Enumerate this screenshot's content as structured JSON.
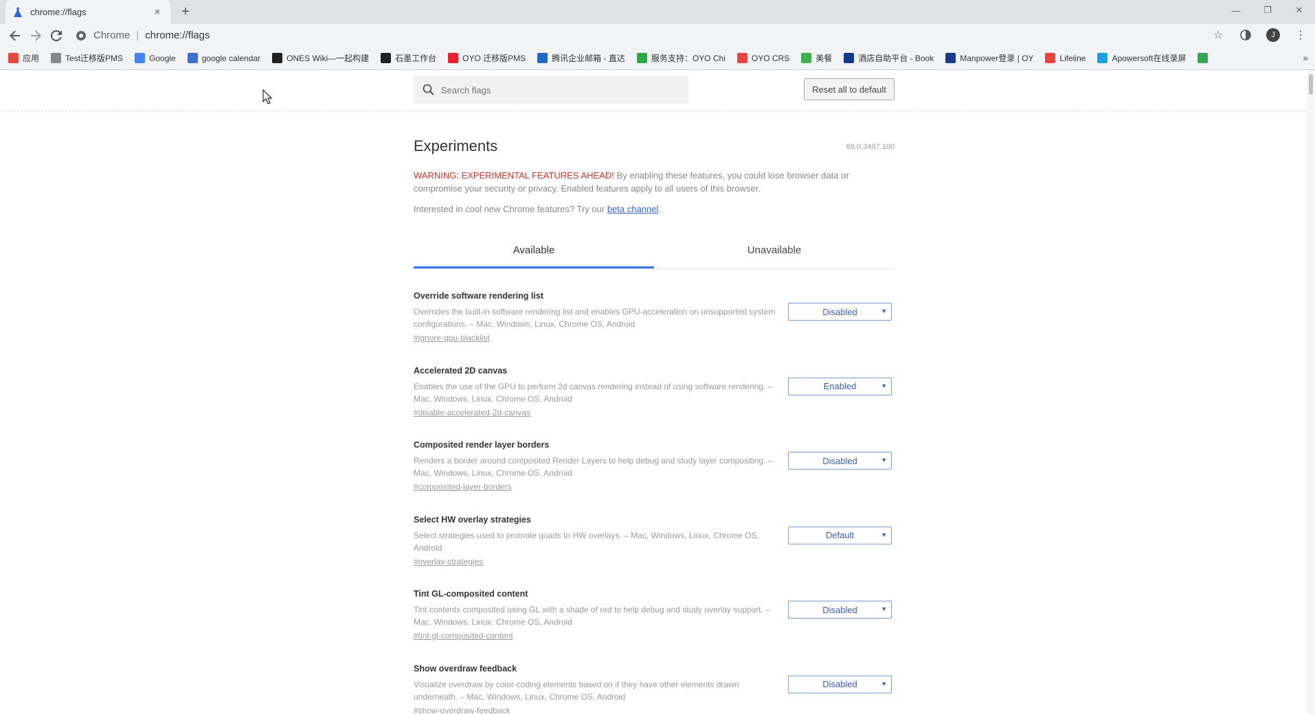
{
  "browser": {
    "tab_title": "chrome://flags",
    "new_tab_symbol": "+",
    "close_symbol": "×",
    "omnibox_scheme": "Chrome",
    "omnibox_separator": "|",
    "omnibox_url": "chrome://flags"
  },
  "bookmarks": [
    {
      "label": "应用",
      "icon": "apps-grid-icon",
      "color": "#e8453c"
    },
    {
      "label": "Test迁移版PMS",
      "icon": "page-icon",
      "color": "#888888"
    },
    {
      "label": "Google",
      "icon": "google-icon",
      "color": "#4285f4"
    },
    {
      "label": "google calendar",
      "icon": "calendar-icon",
      "color": "#3b6fd4"
    },
    {
      "label": "ONES Wiki—一起构建",
      "icon": "ones-icon",
      "color": "#222222"
    },
    {
      "label": "石墨工作台",
      "icon": "shimo-icon",
      "color": "#222222"
    },
    {
      "label": "OYO 迁移版PMS",
      "icon": "oyo-icon",
      "color": "#e8212e"
    },
    {
      "label": "腾讯企业邮箱 - 直达",
      "icon": "mail-icon",
      "color": "#2468c4"
    },
    {
      "label": "服务支持：OYO Chi",
      "icon": "support-icon",
      "color": "#29a845"
    },
    {
      "label": "OYO CRS",
      "icon": "pin-icon",
      "color": "#e8453c"
    },
    {
      "label": "美餐",
      "icon": "meican-icon",
      "color": "#3db24b"
    },
    {
      "label": "酒店自助平台 - Book",
      "icon": "booking-icon",
      "color": "#123a8c"
    },
    {
      "label": "Manpower登录 | OY",
      "icon": "manpower-icon",
      "color": "#1a3a8a"
    },
    {
      "label": "Lifeline",
      "icon": "lifeline-icon",
      "color": "#e8453c"
    },
    {
      "label": "Apowersoft在线录屏",
      "icon": "apowersoft-icon",
      "color": "#1ba1e2"
    },
    {
      "label": "",
      "icon": "drive-icon",
      "color": "#34a853"
    }
  ],
  "bookmarks_more": "»",
  "search": {
    "placeholder": "Search flags"
  },
  "reset_label": "Reset all to default",
  "page": {
    "title": "Experiments",
    "version": "69.0.3497.100",
    "warning_label": "WARNING: EXPERIMENTAL FEATURES AHEAD!",
    "warning_text": " By enabling these features, you could lose browser data or compromise your security or privacy. Enabled features apply to all users of this browser.",
    "beta_prefix": "Interested in cool new Chrome features? Try our ",
    "beta_link": "beta channel",
    "beta_suffix": "."
  },
  "tabs": [
    {
      "label": "Available",
      "active": true
    },
    {
      "label": "Unavailable",
      "active": false
    }
  ],
  "flags": [
    {
      "name": "Override software rendering list",
      "desc": "Overrides the built-in software rendering list and enables GPU-acceleration on unsupported system configurations. – Mac, Windows, Linux, Chrome OS, Android",
      "link": "#ignore-gpu-blacklist",
      "value": "Disabled"
    },
    {
      "name": "Accelerated 2D canvas",
      "desc": "Enables the use of the GPU to perform 2d canvas rendering instead of using software rendering. – Mac, Windows, Linux, Chrome OS, Android",
      "link": "#disable-accelerated-2d-canvas",
      "value": "Enabled"
    },
    {
      "name": "Composited render layer borders",
      "desc": "Renders a border around composited Render Layers to help debug and study layer compositing. – Mac, Windows, Linux, Chrome OS, Android",
      "link": "#composited-layer-borders",
      "value": "Disabled"
    },
    {
      "name": "Select HW overlay strategies",
      "desc": "Select strategies used to promote quads to HW overlays. – Mac, Windows, Linux, Chrome OS, Android",
      "link": "#overlay-strategies",
      "value": "Default"
    },
    {
      "name": "Tint GL-composited content",
      "desc": "Tint contents composited using GL with a shade of red to help debug and study overlay support. – Mac, Windows, Linux, Chrome OS, Android",
      "link": "#tint-gl-composited-content",
      "value": "Disabled"
    },
    {
      "name": "Show overdraw feedback",
      "desc": "Visualize overdraw by color-coding elements based on if they have other elements drawn underneath. – Mac, Windows, Linux, Chrome OS, Android",
      "link": "#show-overdraw-feedback",
      "value": "Disabled"
    }
  ],
  "colors": {
    "accent": "#3b78e7",
    "warning": "#d93025",
    "link": "#3367d6"
  }
}
